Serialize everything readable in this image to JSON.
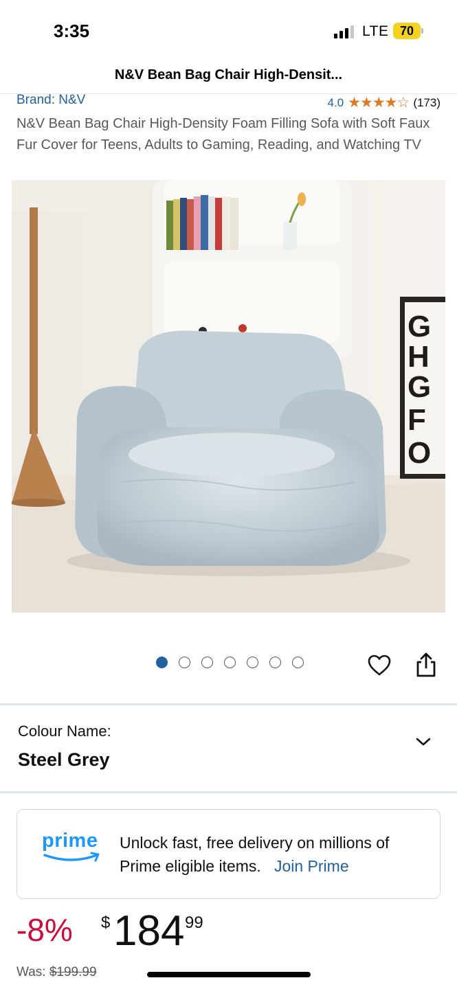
{
  "status_bar": {
    "time": "3:35",
    "network": "LTE",
    "battery": "70",
    "colors": {
      "battery": "#f5d21f"
    }
  },
  "nav": {
    "title": "N&V Bean Bag Chair High-Densit..."
  },
  "product": {
    "brand": "Brand: N&V",
    "rating_value": "4.0",
    "rating": 4.0,
    "stars_text": "★★★★☆",
    "review_count": "(173)",
    "title": "N&V Bean Bag Chair High-Density Foam Filling Sofa with Soft Faux Fur Cover for Teens, Adults to Gaming, Reading, and Watching TV",
    "image_alt": "light grey faux fur bean bag chair",
    "poster_letters": [
      "G",
      "H",
      "G",
      "F",
      "O"
    ]
  },
  "carousel": {
    "count": 7,
    "active_index": 0,
    "icons": {
      "favorite": "heart-icon",
      "share": "share-icon"
    }
  },
  "colour": {
    "label": "Colour Name:",
    "value": "Steel Grey",
    "icon": "chevron-down-icon"
  },
  "prime": {
    "logo": "prime",
    "message": "Unlock fast, free delivery on millions of Prime eligible items.",
    "link": "Join Prime",
    "colors": {
      "logo": "#1a98ff",
      "link": "#2162a1"
    }
  },
  "price": {
    "discount": "-8%",
    "currency": "$",
    "whole": "184",
    "fraction": "99",
    "was_label": "Was:",
    "was_value": "$199.99",
    "colors": {
      "discount": "#cc0c39"
    }
  }
}
